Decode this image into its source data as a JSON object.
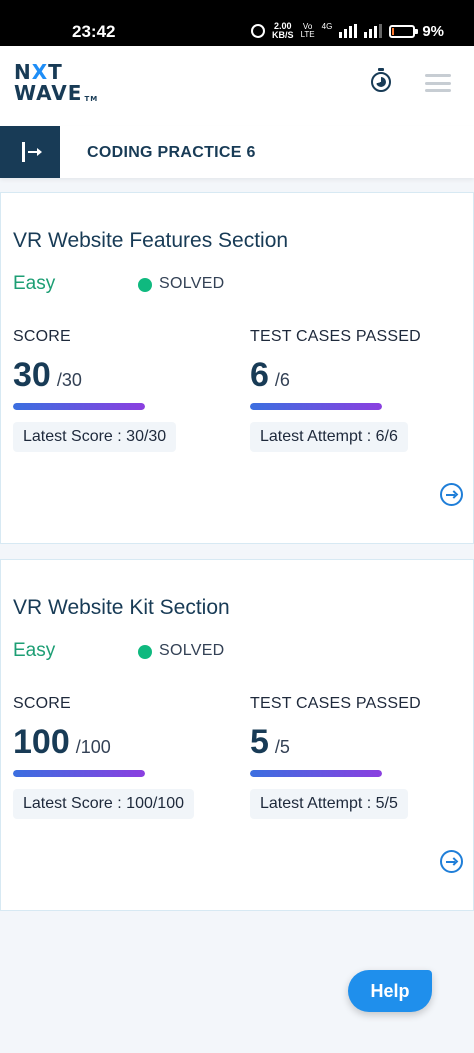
{
  "status_bar": {
    "time": "23:42",
    "speed_value": "2.00",
    "speed_unit": "KB/S",
    "volte_top": "Vo",
    "volte_bottom": "LTE",
    "network_label": "4G",
    "battery_percent": "9%",
    "battery_level": 0.09,
    "battery_color": "#ff7a30"
  },
  "header": {
    "logo_line1_a": "N",
    "logo_line1_b": "X",
    "logo_line1_c": "T",
    "logo_line2": "WAVE",
    "logo_tm": "TM",
    "timer_icon": "stopwatch-icon",
    "menu_icon": "hamburger-icon"
  },
  "subheader": {
    "toggle_icon": "sidebar-toggle-icon",
    "title": "CODING PRACTICE 6"
  },
  "cards": [
    {
      "title": "VR Website Features Section",
      "difficulty": "Easy",
      "status": "SOLVED",
      "score_label": "SCORE",
      "score": "30",
      "score_total": "/30",
      "score_fraction": 1.0,
      "latest_score": "Latest Score : 30/30",
      "tests_label": "TEST CASES PASSED",
      "tests": "6",
      "tests_total": "/6",
      "tests_fraction": 1.0,
      "latest_attempt": "Latest Attempt : 6/6"
    },
    {
      "title": "VR Website Kit Section",
      "difficulty": "Easy",
      "status": "SOLVED",
      "score_label": "SCORE",
      "score": "100",
      "score_total": "/100",
      "score_fraction": 1.0,
      "latest_score": "Latest Score : 100/100",
      "tests_label": "TEST CASES PASSED",
      "tests": "5",
      "tests_total": "/5",
      "tests_fraction": 1.0,
      "latest_attempt": "Latest Attempt : 5/5"
    }
  ],
  "help": {
    "label": "Help"
  },
  "colors": {
    "brand_navy": "#183b56",
    "accent_blue": "#1f8fec",
    "easy_green": "#1d9e74",
    "solved_dot": "#0fb97f"
  }
}
